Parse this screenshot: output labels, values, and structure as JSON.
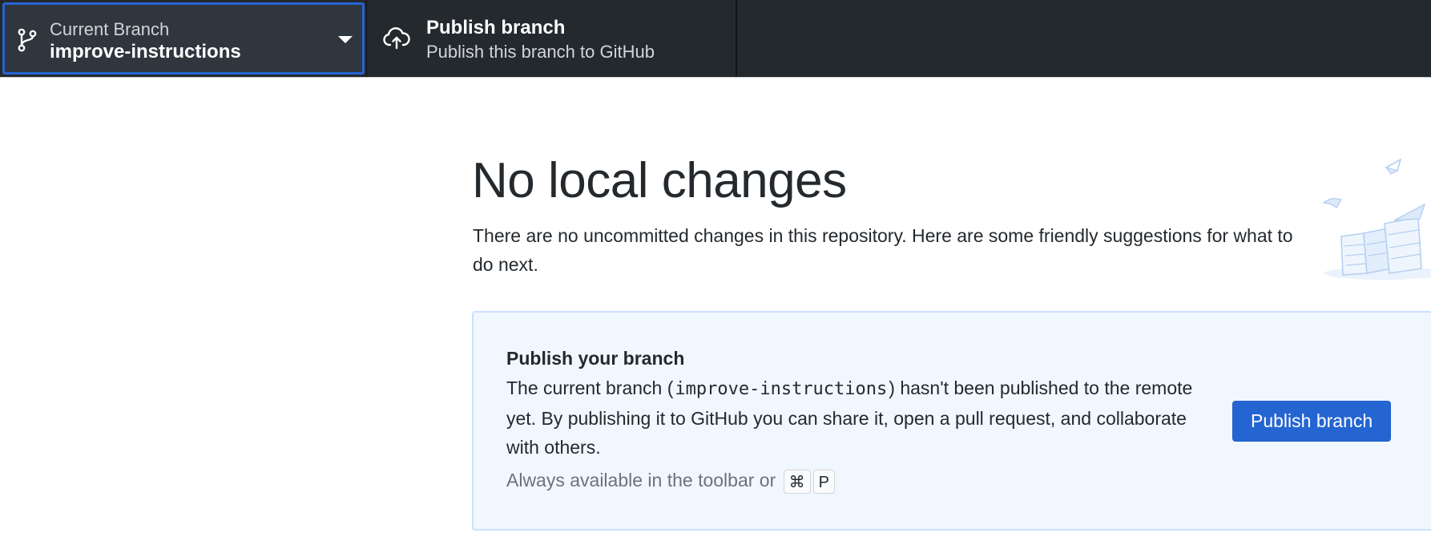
{
  "toolbar": {
    "branch": {
      "label": "Current Branch",
      "name": "improve-instructions",
      "icon": "git-branch-icon",
      "dropdown_icon": "caret-down-icon"
    },
    "publish": {
      "title": "Publish branch",
      "subtitle": "Publish this branch to GitHub",
      "icon": "cloud-upload-icon"
    }
  },
  "main": {
    "heading": "No local changes",
    "intro": "There are no uncommitted changes in this repository. Here are some friendly suggestions for what to do next.",
    "illustration": "empty-boxes-illustration"
  },
  "card": {
    "title": "Publish your branch",
    "desc_before": "The current branch (",
    "branch_code": "improve-instructions",
    "desc_after": ") hasn't been published to the remote yet. By publishing it to GitHub you can share it, open a pull request, and collaborate with others.",
    "hint": "Always available in the toolbar or",
    "shortcut_keys": [
      "⌘",
      "P"
    ],
    "button_label": "Publish branch"
  },
  "colors": {
    "toolbar_bg": "#24292e",
    "accent_blue": "#2565d2",
    "card_bg": "#f1f7fe",
    "card_border": "#c8e1ff"
  }
}
